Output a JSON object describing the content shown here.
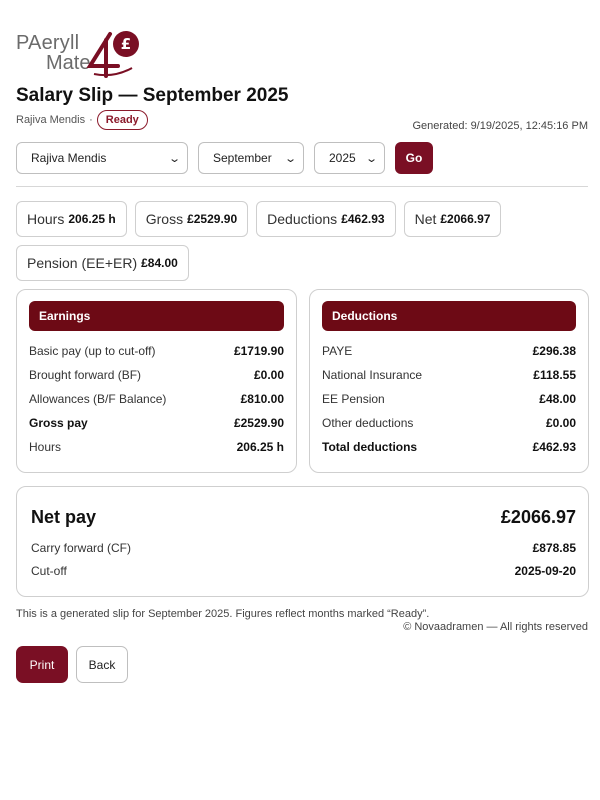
{
  "brand": {
    "line1": "PAeryll",
    "line2": "Mate",
    "accent": "#7a0f24",
    "logo_icon": "pound-four-logo-icon"
  },
  "header": {
    "title": "Salary Slip — September 2025",
    "employee": "Rajiva Mendis",
    "separator": "·",
    "status": "Ready",
    "generated": "Generated: 9/19/2025, 12:45:16 PM"
  },
  "filters": {
    "employee": "Rajiva Mendis",
    "month": "September",
    "year": "2025",
    "go_label": "Go"
  },
  "summary": {
    "hours_label": "Hours",
    "hours_value": "206.25 h",
    "gross_label": "Gross",
    "gross_value": "£2529.90",
    "deductions_label": "Deductions",
    "deductions_value": "£462.93",
    "net_label": "Net",
    "net_value": "£2066.97",
    "pension_label": "Pension (EE+ER)",
    "pension_value": "£84.00"
  },
  "earnings": {
    "title": "Earnings",
    "rows": [
      {
        "label": "Basic pay (up to cut-off)",
        "value": "£1719.90"
      },
      {
        "label": "Brought forward (BF)",
        "value": "£0.00"
      },
      {
        "label": "Allowances (B/F Balance)",
        "value": "£810.00"
      },
      {
        "label": "Gross pay",
        "value": "£2529.90"
      },
      {
        "label": "Hours",
        "value": "206.25 h"
      }
    ]
  },
  "deductions": {
    "title": "Deductions",
    "rows": [
      {
        "label": "PAYE",
        "value": "£296.38"
      },
      {
        "label": "National Insurance",
        "value": "£118.55"
      },
      {
        "label": "EE Pension",
        "value": "£48.00"
      },
      {
        "label": "Other deductions",
        "value": "£0.00"
      },
      {
        "label": "Total deductions",
        "value": "£462.93"
      }
    ]
  },
  "net": {
    "label": "Net pay",
    "value": "£2066.97",
    "carry_label": "Carry forward (CF)",
    "carry_value": "£878.85",
    "cutoff_label": "Cut-off",
    "cutoff_value": "2025-09-20"
  },
  "footer": {
    "note": "This is a generated slip for September 2025. Figures reflect months marked “Ready”.",
    "copyright": "© Novaadramen — All rights reserved"
  },
  "actions": {
    "print_label": "Print",
    "back_label": "Back"
  }
}
